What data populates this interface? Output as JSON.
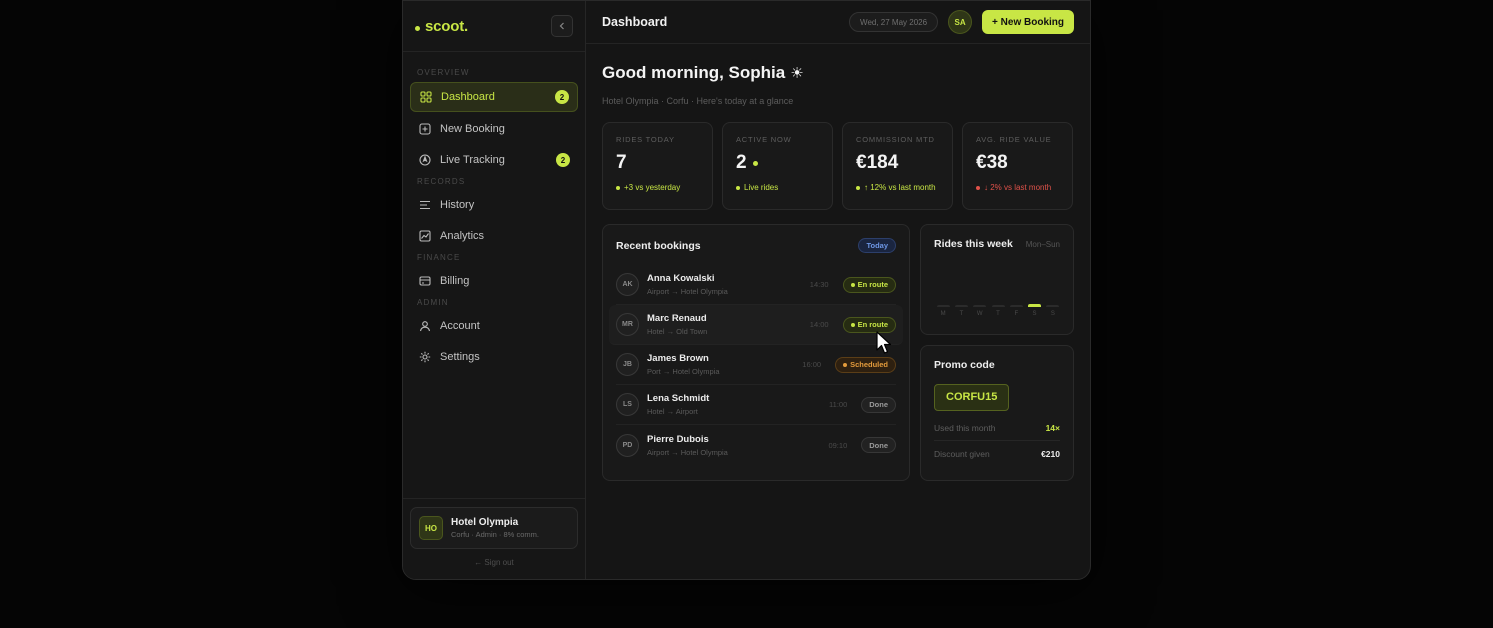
{
  "colors": {
    "accent": "#c8e645",
    "danger": "#e0524a",
    "warning": "#e39b3c",
    "info": "#6e97e6"
  },
  "sidebar": {
    "brand": "scoot.",
    "sections": {
      "overview": "OVERVIEW",
      "records": "RECORDS",
      "finance": "FINANCE",
      "admin": "ADMIN"
    },
    "items": [
      {
        "label": "Dashboard",
        "icon": "grid-icon",
        "badge": "2",
        "active": true
      },
      {
        "label": "New Booking",
        "icon": "plus-square-icon"
      },
      {
        "label": "Live Tracking",
        "icon": "compass-icon",
        "badge": "2"
      },
      {
        "label": "History",
        "icon": "list-icon"
      },
      {
        "label": "Analytics",
        "icon": "chart-icon"
      },
      {
        "label": "Billing",
        "icon": "card-icon"
      },
      {
        "label": "Account",
        "icon": "user-icon"
      },
      {
        "label": "Settings",
        "icon": "gear-icon"
      }
    ],
    "footer": {
      "avatar": "HO",
      "name": "Hotel Olympia",
      "meta": "Corfu · Admin · 8% comm.",
      "signout": "← Sign out"
    }
  },
  "topbar": {
    "title": "Dashboard",
    "date": "Wed, 27 May 2026",
    "user_initials": "SA",
    "new_booking": "+ New Booking"
  },
  "greeting": {
    "title": "Good morning, Sophia",
    "sub": "Hotel Olympia · Corfu · Here's today at a glance"
  },
  "stats": [
    {
      "label": "RIDES TODAY",
      "value": "7",
      "delta": "+3 vs yesterday",
      "trend": "up"
    },
    {
      "label": "ACTIVE NOW",
      "value": "2",
      "delta": "Live rides",
      "trend": "up"
    },
    {
      "label": "COMMISSION MTD",
      "value": "€184",
      "delta": "↑ 12% vs last month",
      "trend": "up"
    },
    {
      "label": "AVG. RIDE VALUE",
      "value": "€38",
      "delta": "↓ 2% vs last month",
      "trend": "down"
    }
  ],
  "bookings": {
    "title": "Recent bookings",
    "filter": "Today",
    "rows": [
      {
        "initials": "AK",
        "name": "Anna Kowalski",
        "route": "Airport → Hotel Olympia",
        "time": "14:30",
        "status": "En route",
        "kind": "enroute"
      },
      {
        "initials": "MR",
        "name": "Marc Renaud",
        "route": "Hotel → Old Town",
        "time": "14:00",
        "status": "En route",
        "kind": "enroute"
      },
      {
        "initials": "JB",
        "name": "James Brown",
        "route": "Port → Hotel Olympia",
        "time": "16:00",
        "status": "Scheduled",
        "kind": "scheduled"
      },
      {
        "initials": "LS",
        "name": "Lena Schmidt",
        "route": "Hotel → Airport",
        "time": "11:00",
        "status": "Done",
        "kind": "done"
      },
      {
        "initials": "PD",
        "name": "Pierre Dubois",
        "route": "Airport → Hotel Olympia",
        "time": "09:10",
        "status": "Done",
        "kind": "done"
      }
    ]
  },
  "weekly": {
    "title": "Rides this week",
    "range": "Mon–Sun",
    "days": [
      "M",
      "T",
      "W",
      "T",
      "F",
      "S",
      "S"
    ],
    "values": [
      1,
      1,
      1,
      1,
      1,
      3,
      1
    ],
    "max": 20,
    "active_index": 5
  },
  "promo": {
    "title": "Promo code",
    "code": "CORFU15",
    "used_label": "Used this month",
    "used_value": "14×",
    "discount_label": "Discount given",
    "discount_value": "€210"
  }
}
